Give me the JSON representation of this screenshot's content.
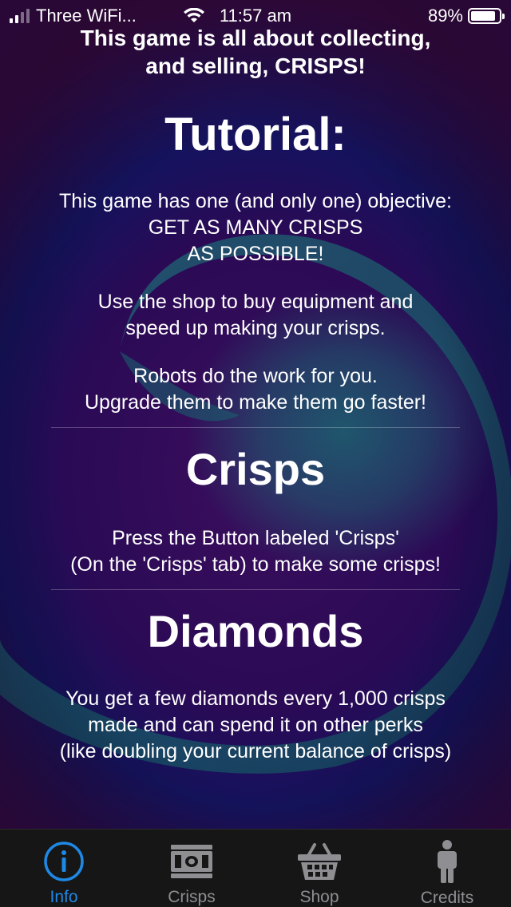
{
  "status_bar": {
    "carrier": "Three WiFi...",
    "time": "11:57 am",
    "battery": "89%",
    "battery_level": 0.89
  },
  "content": {
    "intro": "This game is all about collecting, and selling, CRISPS!",
    "title": "Tutorial:",
    "objective_lines": [
      "This game has one (and only one) objective:",
      "GET AS MANY CRISPS",
      "AS POSSIBLE!"
    ],
    "shop_lines": [
      "Use the shop to buy equipment and",
      "speed up making your crisps."
    ],
    "robots_lines": [
      "Robots do the work for you.",
      "Upgrade them to make them go faster!"
    ],
    "crisps_heading": "Crisps",
    "crisps_lines": [
      "Press the Button labeled 'Crisps'",
      "(On the 'Crisps' tab) to make some crisps!"
    ],
    "diamonds_heading": "Diamonds",
    "diamonds_lines": [
      "You get a few diamonds every 1,000 crisps",
      "made and can spend it on other perks",
      "(like doubling your current balance of crisps)"
    ]
  },
  "tabbar": {
    "tabs": [
      {
        "label": "Info",
        "icon": "info-icon",
        "active": true
      },
      {
        "label": "Crisps",
        "icon": "banknote-icon",
        "active": false
      },
      {
        "label": "Shop",
        "icon": "basket-icon",
        "active": false
      },
      {
        "label": "Credits",
        "icon": "person-icon",
        "active": false
      }
    ]
  },
  "colors": {
    "active_tab": "#1e88e5",
    "inactive_tab": "#8e8e93",
    "tabbar_bg": "#161616"
  }
}
